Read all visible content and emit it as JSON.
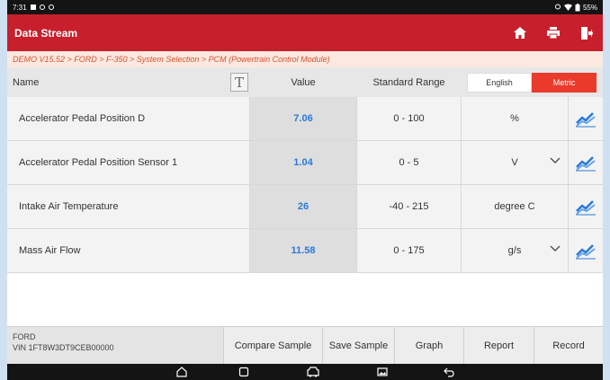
{
  "status": {
    "time": "7:31",
    "battery": "55%"
  },
  "header": {
    "title": "Data Stream"
  },
  "breadcrumb": "DEMO V15.52 > FORD > F-350 > System Selection > PCM (Powertrain Control Module)",
  "table": {
    "col_name": "Name",
    "col_value": "Value",
    "col_range": "Standard Range",
    "font_button": "T",
    "unit_english": "English",
    "unit_metric": "Metric",
    "rows": [
      {
        "name": "Accelerator Pedal Position D",
        "value": "7.06",
        "range": "0 - 100",
        "unit": "%",
        "dropdown": false
      },
      {
        "name": "Accelerator Pedal Position Sensor 1",
        "value": "1.04",
        "range": "0 - 5",
        "unit": "V",
        "dropdown": true
      },
      {
        "name": "Intake Air Temperature",
        "value": "26",
        "range": "-40 - 215",
        "unit": "degree C",
        "dropdown": false
      },
      {
        "name": "Mass Air Flow",
        "value": "11.58",
        "range": "0 - 175",
        "unit": "g/s",
        "dropdown": true
      }
    ]
  },
  "footer": {
    "make": "FORD",
    "vin": "VIN 1FT8W3DT9CEB00000",
    "buttons": [
      "Compare Sample",
      "Save Sample",
      "Graph",
      "Report",
      "Record"
    ]
  },
  "colors": {
    "accent": "#c7202c",
    "metric_active": "#ea3a2c",
    "value_text": "#2a79d6",
    "breadcrumb_text": "#d5512e"
  },
  "icons": [
    "home-icon",
    "print-icon",
    "exit-icon",
    "graph-icon",
    "chevron-down-icon",
    "nav-home-icon",
    "nav-recent-icon",
    "nav-vci-icon",
    "nav-screenshot-icon",
    "nav-back-icon"
  ]
}
